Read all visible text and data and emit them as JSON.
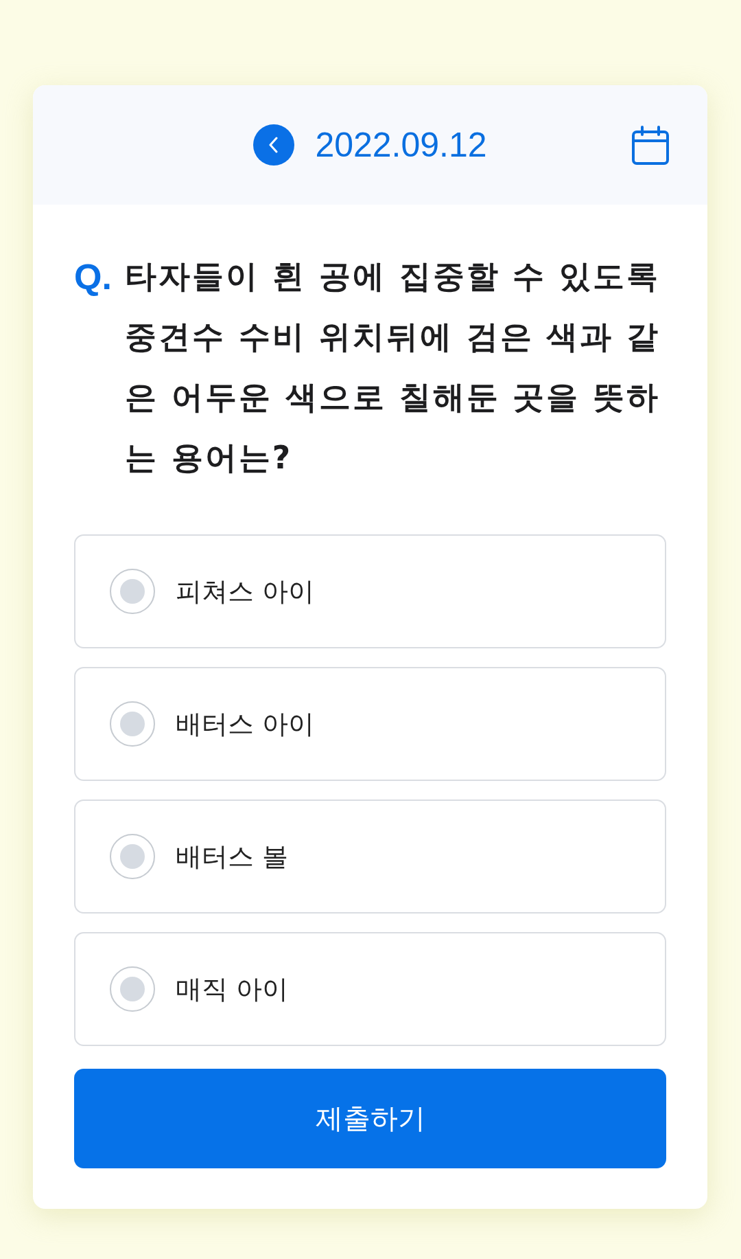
{
  "header": {
    "date": "2022.09.12"
  },
  "question": {
    "marker": "Q.",
    "text": "타자들이 흰 공에 집중할 수 있도록 중견수 수비 위치뒤에 검은 색과 같은 어두운 색으로 칠해둔 곳을 뜻하는 용어는?"
  },
  "options": [
    {
      "label": "피쳐스 아이",
      "selected": false
    },
    {
      "label": "배터스 아이",
      "selected": false
    },
    {
      "label": "배터스 볼",
      "selected": false
    },
    {
      "label": "매직 아이",
      "selected": false
    }
  ],
  "submit_button": {
    "label": "제출하기"
  }
}
